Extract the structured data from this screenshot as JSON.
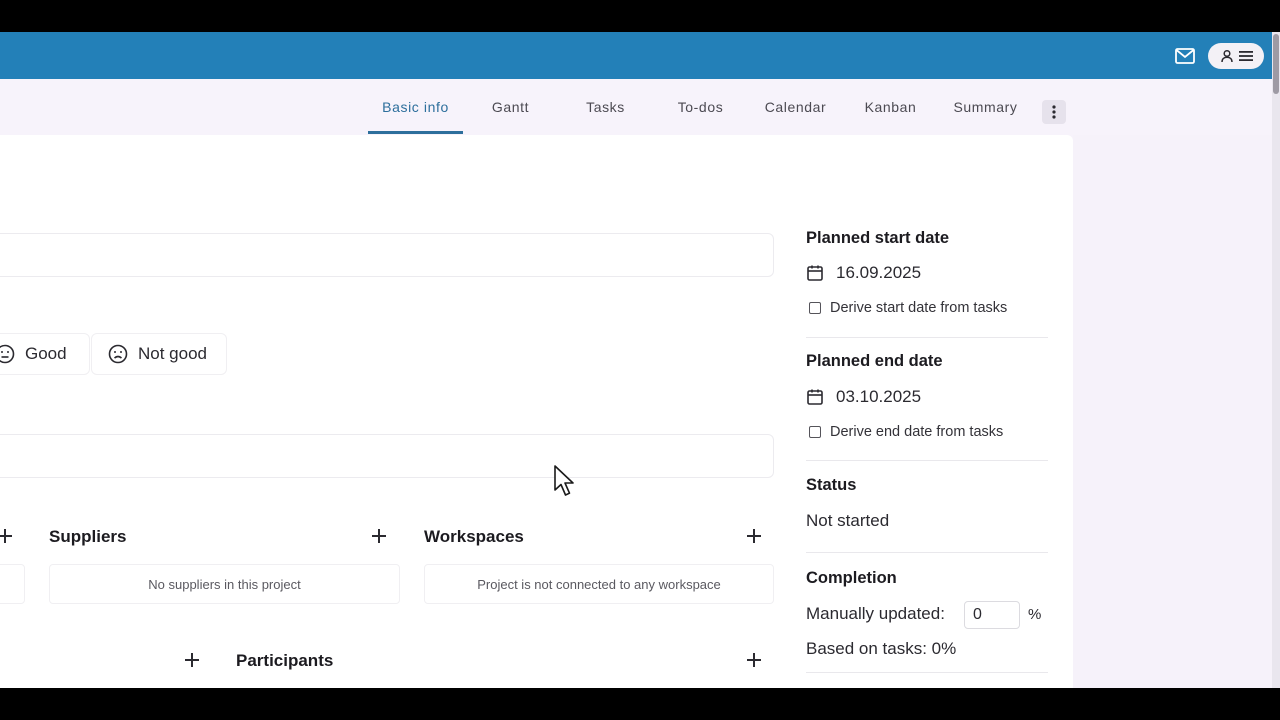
{
  "header": {
    "mail_icon": "mail-icon",
    "user_icon": "person-icon",
    "menu_icon": "hamburger-icon"
  },
  "tabs": [
    {
      "label": "Basic info",
      "active": true
    },
    {
      "label": "Gantt",
      "active": false
    },
    {
      "label": "Tasks",
      "active": false
    },
    {
      "label": "To-dos",
      "active": false
    },
    {
      "label": "Calendar",
      "active": false
    },
    {
      "label": "Kanban",
      "active": false
    },
    {
      "label": "Summary",
      "active": false
    }
  ],
  "mood": {
    "good_label": "Good",
    "not_good_label": "Not good"
  },
  "suppliers": {
    "title": "Suppliers",
    "empty_text": "No suppliers in this project"
  },
  "workspaces": {
    "title": "Workspaces",
    "empty_text": "Project is not connected to any workspace"
  },
  "participants": {
    "title": "Participants"
  },
  "details": {
    "planned_start": {
      "heading": "Planned start date",
      "value": "16.09.2025",
      "derive_label": "Derive start date from tasks"
    },
    "planned_end": {
      "heading": "Planned end date",
      "value": "03.10.2025",
      "derive_label": "Derive end date from tasks"
    },
    "status": {
      "heading": "Status",
      "value": "Not started"
    },
    "completion": {
      "heading": "Completion",
      "manual_label": "Manually updated:",
      "manual_value": "0",
      "percent_sign": "%",
      "based_on_tasks": "Based on tasks: 0%"
    }
  },
  "colors": {
    "topbar": "#2380b8",
    "active_tab": "#2d6f9c",
    "background": "#f7f3fb"
  }
}
